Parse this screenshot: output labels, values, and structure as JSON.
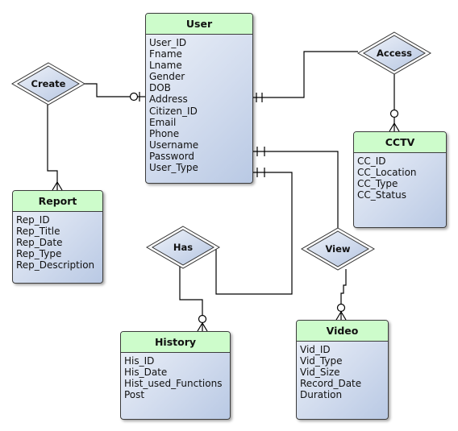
{
  "diagram": {
    "type": "entity-relationship",
    "colors": {
      "entity_header": "#cdfccb",
      "entity_body_light": "#eef2f9",
      "entity_body_dark": "#b9c9e4",
      "line": "#000000"
    },
    "entities": {
      "user": {
        "name": "User",
        "attributes": [
          "User_ID",
          "Fname",
          "Lname",
          "Gender",
          "DOB",
          "Address",
          "Citizen_ID",
          "Email",
          "Phone",
          "Username",
          "Password",
          "User_Type"
        ]
      },
      "report": {
        "name": "Report",
        "attributes": [
          "Rep_ID",
          "Rep_Title",
          "Rep_Date",
          "Rep_Type",
          "Rep_Description"
        ]
      },
      "cctv": {
        "name": "CCTV",
        "attributes": [
          "CC_ID",
          "CC_Location",
          "CC_Type",
          "CC_Status"
        ]
      },
      "history": {
        "name": "History",
        "attributes": [
          "His_ID",
          "His_Date",
          "Hist_used_Functions",
          "Post"
        ]
      },
      "video": {
        "name": "Video",
        "attributes": [
          "Vid_ID",
          "Vid_Type",
          "Vid_Size",
          "Record_Date",
          "Duration"
        ]
      }
    },
    "relationships": {
      "create": {
        "name": "Create",
        "from": "User",
        "to": "Report",
        "from_cardinality": "zero-or-one",
        "to_cardinality": "many"
      },
      "access": {
        "name": "Access",
        "from": "User",
        "to": "CCTV",
        "from_cardinality": "exactly-one",
        "to_cardinality": "zero-or-many"
      },
      "has": {
        "name": "Has",
        "from": "User",
        "to": "History",
        "from_cardinality": "exactly-one",
        "to_cardinality": "zero-or-many"
      },
      "view": {
        "name": "View",
        "from": "User",
        "to": "Video",
        "from_cardinality": "exactly-one",
        "to_cardinality": "zero-or-many"
      }
    }
  }
}
